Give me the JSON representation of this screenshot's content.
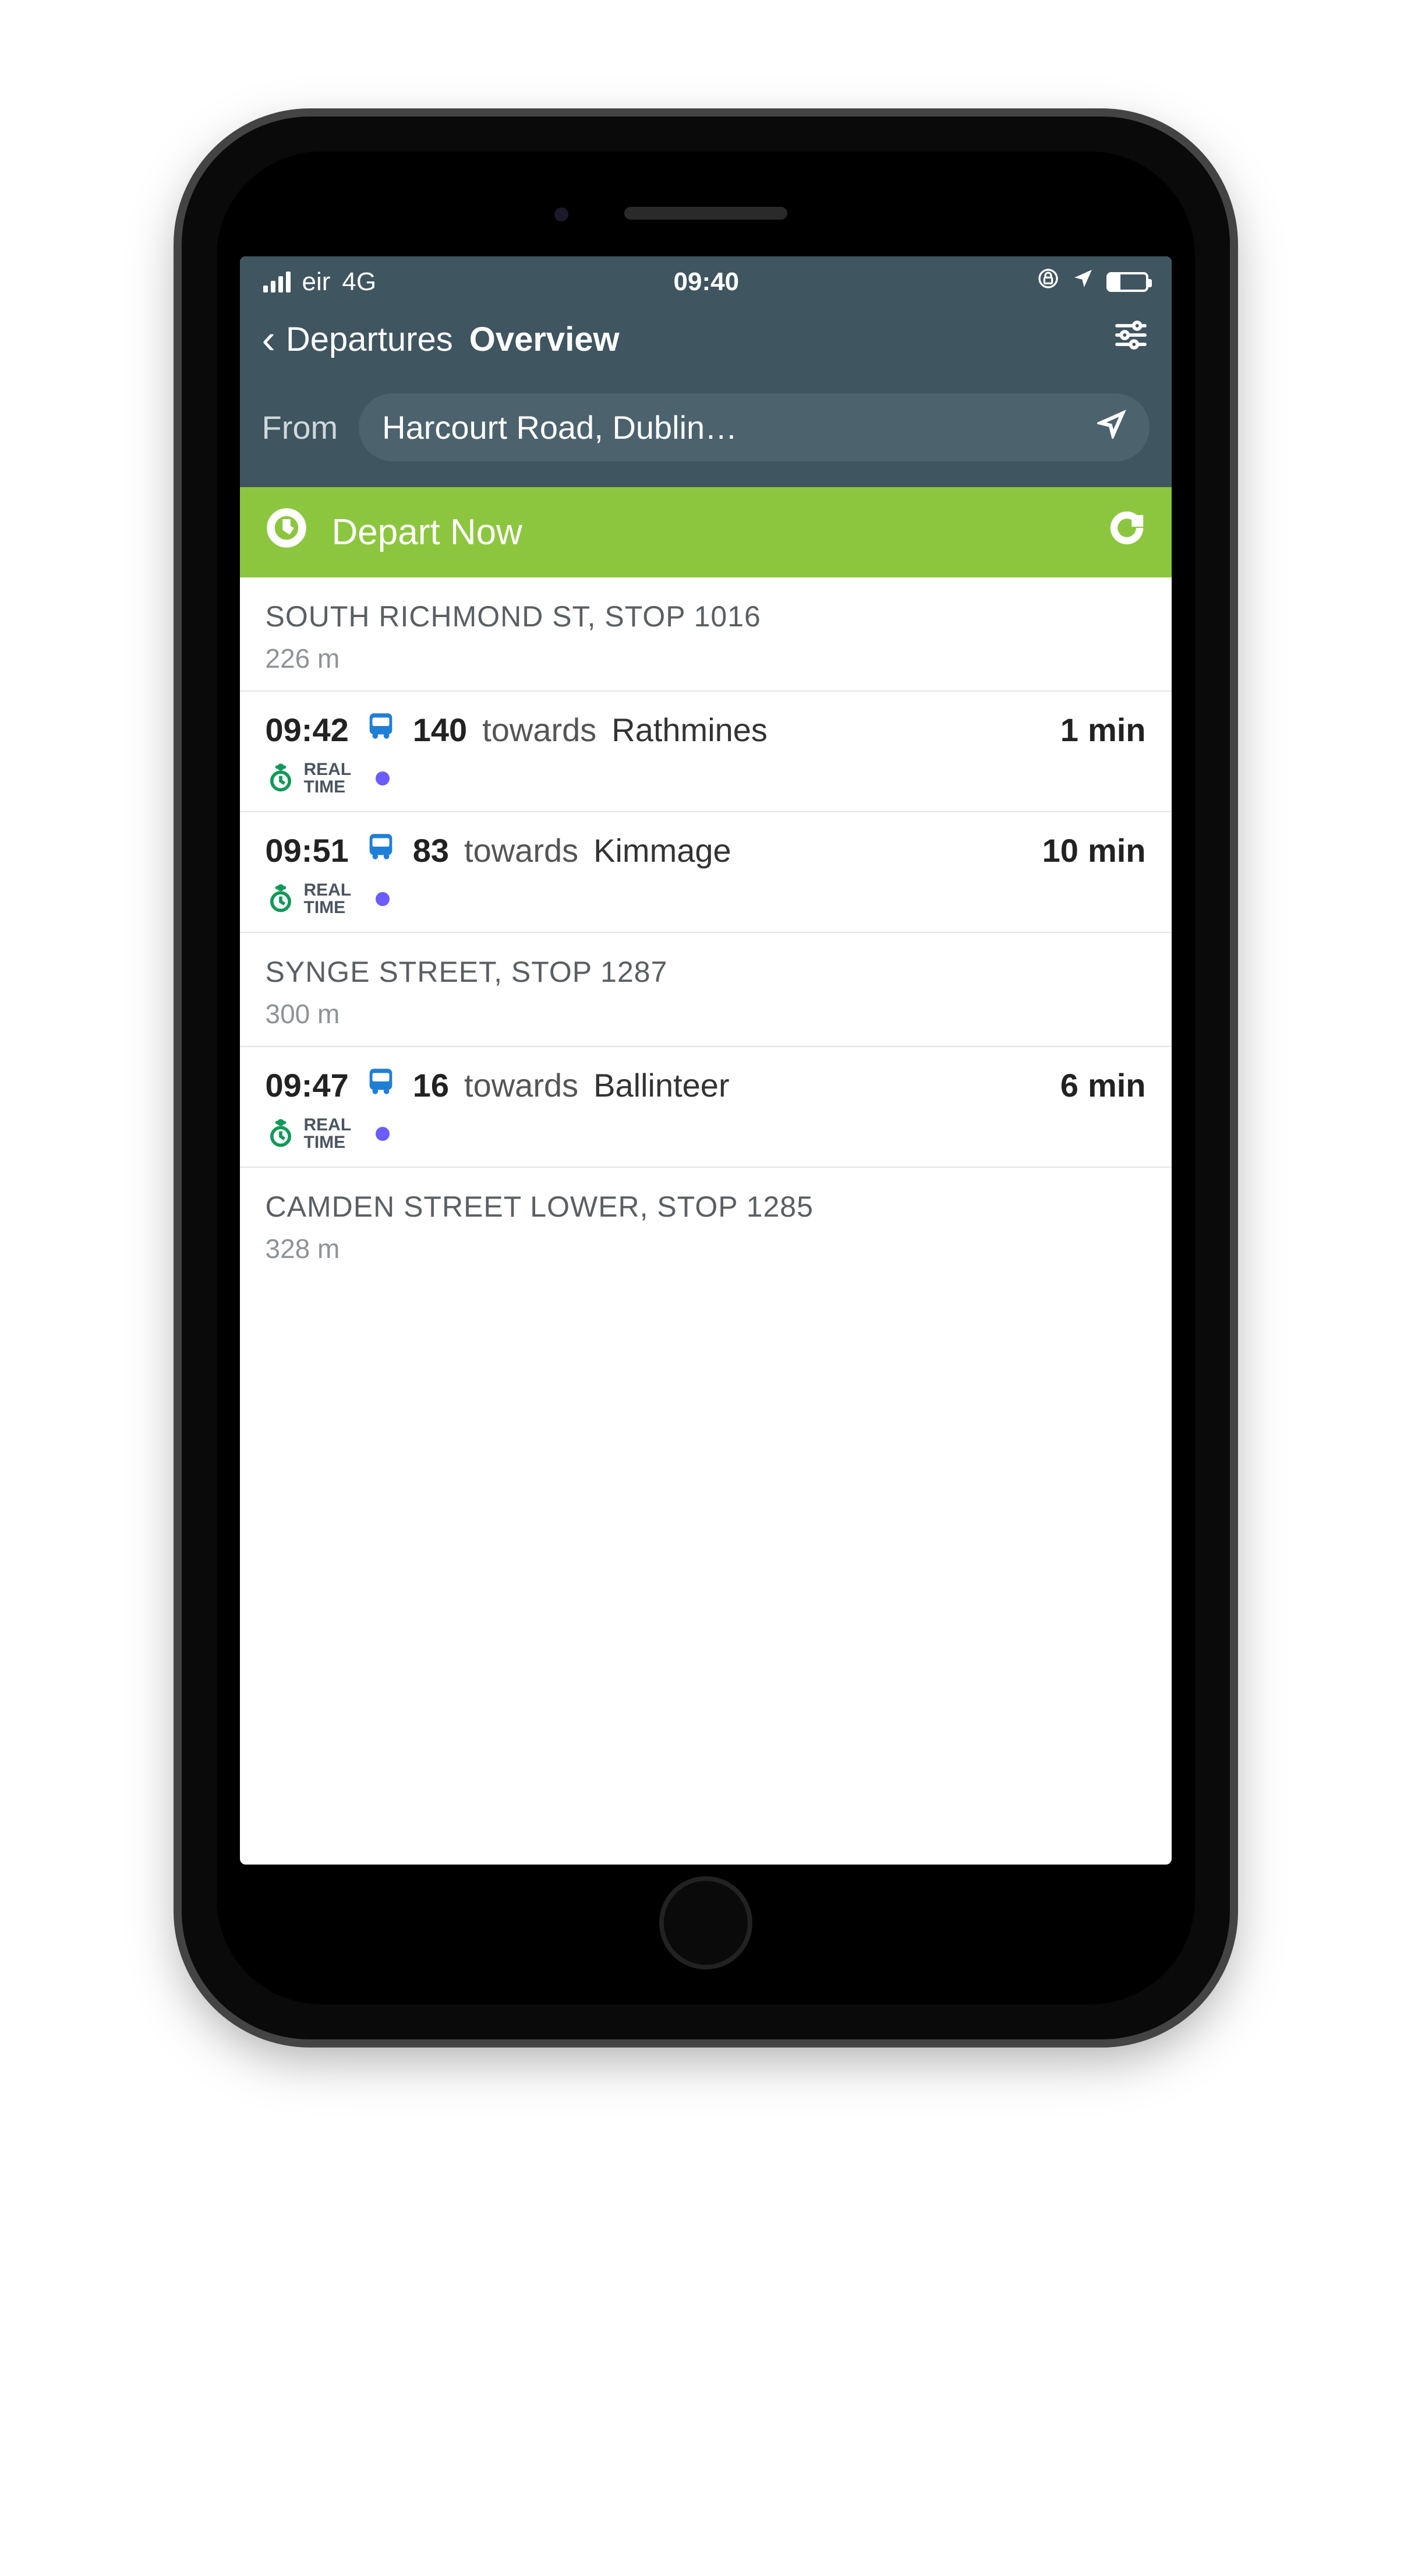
{
  "statusbar": {
    "carrier": "eir",
    "network": "4G",
    "time": "09:40"
  },
  "nav": {
    "back_label": "Departures",
    "title": "Overview"
  },
  "from": {
    "label": "From",
    "value": "Harcourt Road, Dublin…"
  },
  "depart_bar": {
    "label": "Depart Now"
  },
  "stops": [
    {
      "name": "SOUTH RICHMOND ST, STOP 1016",
      "distance": "226 m",
      "departures": [
        {
          "time": "09:42",
          "route": "140",
          "towards": "towards",
          "dest": "Rathmines",
          "eta_value": "1",
          "eta_unit": "min",
          "realtime_l1": "REAL",
          "realtime_l2": "TIME"
        },
        {
          "time": "09:51",
          "route": "83",
          "towards": "towards",
          "dest": "Kimmage",
          "eta_value": "10",
          "eta_unit": "min",
          "realtime_l1": "REAL",
          "realtime_l2": "TIME"
        }
      ]
    },
    {
      "name": "SYNGE STREET, STOP 1287",
      "distance": "300 m",
      "departures": [
        {
          "time": "09:47",
          "route": "16",
          "towards": "towards",
          "dest": "Ballinteer",
          "eta_value": "6",
          "eta_unit": "min",
          "realtime_l1": "REAL",
          "realtime_l2": "TIME"
        }
      ]
    },
    {
      "name": "CAMDEN STREET LOWER, STOP 1285",
      "distance": "328 m",
      "departures": []
    }
  ]
}
